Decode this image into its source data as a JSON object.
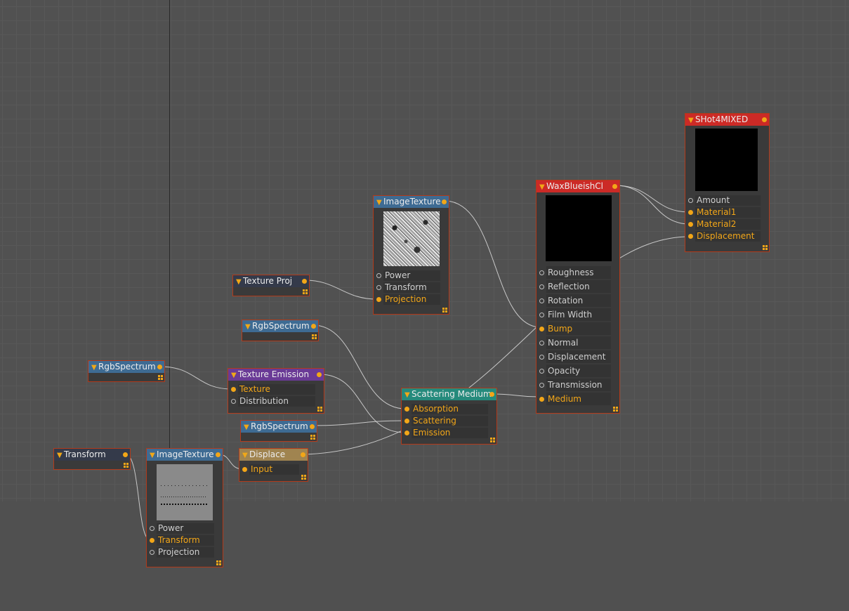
{
  "nodes": {
    "shot": {
      "title": "SHot4MIXED",
      "inputs": [
        "Amount",
        "Material1",
        "Material2",
        "Displacement"
      ]
    },
    "wax": {
      "title": "WaxBlueishCl",
      "inputs": [
        "Roughness",
        "Reflection",
        "Rotation",
        "Film Width",
        "Bump",
        "Normal",
        "Displacement",
        "Opacity",
        "Transmission",
        "Medium"
      ]
    },
    "imgtex_top": {
      "title": "ImageTexture",
      "inputs": [
        "Power",
        "Transform",
        "Projection"
      ]
    },
    "texproj": {
      "title": "Texture Proj"
    },
    "rgb1": {
      "title": "RgbSpectrum"
    },
    "rgb_left": {
      "title": "RgbSpectrum"
    },
    "texemit": {
      "title": "Texture Emission",
      "inputs": [
        "Texture",
        "Distribution"
      ]
    },
    "scatter": {
      "title": "Scattering Medium",
      "inputs": [
        "Absorption",
        "Scattering",
        "Emission"
      ]
    },
    "rgb2": {
      "title": "RgbSpectrum"
    },
    "transform": {
      "title": "Transform"
    },
    "imgtex_bot": {
      "title": "ImageTexture",
      "inputs": [
        "Power",
        "Transform",
        "Projection"
      ]
    },
    "displace": {
      "title": "Displace",
      "inputs": [
        "Input"
      ]
    }
  },
  "colors": {
    "canvas": "#515151",
    "node_border": "#b23a1a",
    "port_active": "#f2a618",
    "wire": "#c8c8c8"
  }
}
